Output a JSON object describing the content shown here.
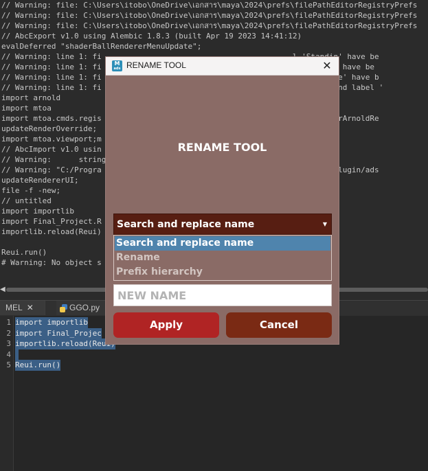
{
  "log": {
    "lines": [
      "// Warning: file: C:\\Users\\itobo\\OneDrive\\เอกสาร\\maya\\2024\\prefs\\filePathEditorRegistryPrefs",
      "// Warning: file: C:\\Users\\itobo\\OneDrive\\เอกสาร\\maya\\2024\\prefs\\filePathEditorRegistryPrefs",
      "// Warning: file: C:\\Users\\itobo\\OneDrive\\เอกสาร\\maya\\2024\\prefs\\filePathEditorRegistryPrefs",
      "// AbcExport v1.0 using Alembic 1.8.3 (built Apr 19 2023 14:41:12)",
      "evalDeferred \"shaderBallRendererMenuUpdate\";",
      "// Warning: line 1: fi                                          l 'Standin' have be",
      "// Warning: line 1: fi                                          abel 'VDB' have be",
      "// Warning: line 1: fi                                          abel 'Image' have b",
      "// Warning: line 1: fi                                          ilename' and label '",
      "import arnold",
      "import mtoa",
      "import mtoa.cmds.regis                                          er.registerArnoldRe",
      "updateRenderOverride;",
      "import mtoa.viewport;m",
      "// AbcImport v1.0 usin",
      "// Warning:      string",
      "// Warning: \"C:/Progra                                          /MayaUSD/plugin/ads",
      "updateRendererUI;",
      "file -f -new;",
      "// untitled",
      "import importlib",
      "import Final_Project.R",
      "importlib.reload(Reui)",
      "",
      "Reui.run()",
      "# Warning: No object s"
    ]
  },
  "editor": {
    "tabs": [
      {
        "label": "MEL",
        "close": "✕"
      },
      {
        "label": "GGO.py",
        "close": "✕"
      }
    ],
    "line_numbers": [
      "1",
      "2",
      "3",
      "4",
      "5"
    ],
    "code": [
      "import importlib",
      "import Final_Projec",
      "importlib.reload(Reui)",
      "",
      "Reui.run()"
    ]
  },
  "dialog": {
    "window_title": "RENAME TOOL",
    "close_glyph": "✕",
    "icon_text": "M",
    "icon_sub": "ads",
    "heading": "RENAME TOOL",
    "mode": {
      "selected": "Search and replace name",
      "caret": "▼",
      "options": [
        "Search and replace name",
        "Rename",
        "Prefix hierarchy"
      ]
    },
    "name_placeholder": "NEW NAME",
    "apply_label": "Apply",
    "cancel_label": "Cancel"
  },
  "colors": {
    "dialog_bg": "#8a6b66",
    "combo_bg": "#571e12",
    "highlight": "#4f84ad",
    "apply": "#b02424",
    "cancel": "#7a2a14"
  }
}
